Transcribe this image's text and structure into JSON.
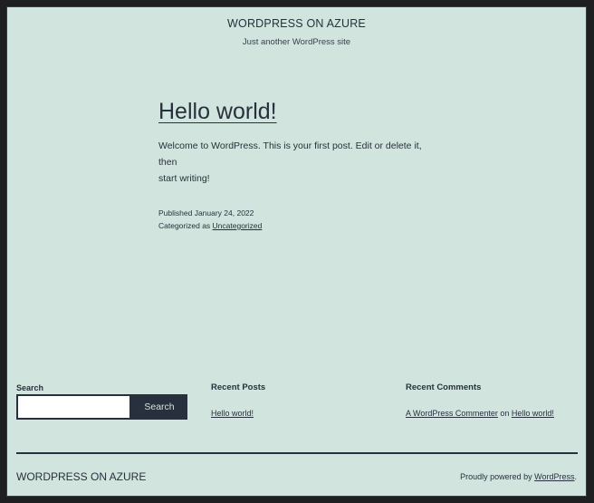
{
  "site": {
    "title": "WORDPRESS ON AZURE",
    "tagline": "Just another WordPress site"
  },
  "post": {
    "title": "Hello world!",
    "body_line1": "Welcome to WordPress. This is your first post. Edit or delete it, then",
    "body_line2": "start writing!",
    "published": "Published January 24, 2022",
    "categorized_prefix": "Categorized as ",
    "category": "Uncategorized"
  },
  "widgets": {
    "search": {
      "label": "Search",
      "placeholder": "",
      "value": "",
      "button_label": "Search"
    },
    "recent_posts": {
      "title": "Recent Posts",
      "items": [
        "Hello world!"
      ]
    },
    "recent_comments": {
      "title": "Recent Comments",
      "author": "A WordPress Commenter",
      "connector": " on ",
      "post": "Hello world!"
    }
  },
  "footer": {
    "site_title": "WORDPRESS ON AZURE",
    "powered_prefix": "Proudly powered by ",
    "powered_link": "WordPress",
    "powered_suffix": "."
  },
  "colors": {
    "background": "#d1e4dd",
    "text": "#28303d",
    "frame": "#1e1f21"
  }
}
